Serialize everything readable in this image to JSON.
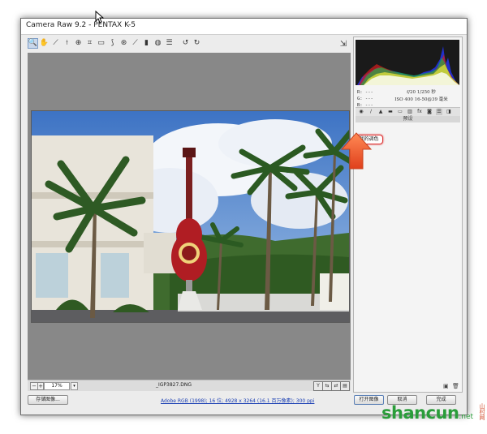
{
  "window": {
    "title": "Camera Raw 9.2 -  PENTAX K-5"
  },
  "toolbar": {
    "tools": [
      {
        "name": "zoom-tool",
        "glyph": "🔍"
      },
      {
        "name": "hand-tool",
        "glyph": "✋"
      },
      {
        "name": "white-balance-tool",
        "glyph": "⟋"
      },
      {
        "name": "color-sampler-tool",
        "glyph": "⟊"
      },
      {
        "name": "targeted-adjustment-tool",
        "glyph": "⊕"
      },
      {
        "name": "crop-tool",
        "glyph": "⌗"
      },
      {
        "name": "straighten-tool",
        "glyph": "▭"
      },
      {
        "name": "spot-removal-tool",
        "glyph": "⟆"
      },
      {
        "name": "red-eye-tool",
        "glyph": "⊛"
      },
      {
        "name": "adjustment-brush-tool",
        "glyph": "⟋"
      },
      {
        "name": "graduated-filter-tool",
        "glyph": "▮"
      },
      {
        "name": "radial-filter-tool",
        "glyph": "◍"
      },
      {
        "name": "preferences-tool",
        "glyph": "☰"
      },
      {
        "name": "rotate-ccw-tool",
        "glyph": "↺"
      },
      {
        "name": "rotate-cw-tool",
        "glyph": "↻"
      }
    ]
  },
  "statusbar": {
    "zoom_value": "17%",
    "filename": "_IGP3827.DNG"
  },
  "panel": {
    "rgb_labels": [
      "R: ---",
      "G: ---",
      "B: ---"
    ],
    "exif_line1": "f/20   1/250 秒",
    "exif_line2": "ISO 400   16-50@39 毫米",
    "section_title": "预设",
    "preset_item": "我的调色"
  },
  "footer": {
    "save_label": "存储图像...",
    "info_link": "Adobe RGB (1998); 16 位; 4928 x 3264 (16.1 百万像素); 300 ppi",
    "open_label": "打开图像",
    "cancel_label": "取消",
    "done_label": "完成"
  },
  "watermark": {
    "brand": "shancun",
    "suffix": ".net",
    "cn": "山村网"
  }
}
